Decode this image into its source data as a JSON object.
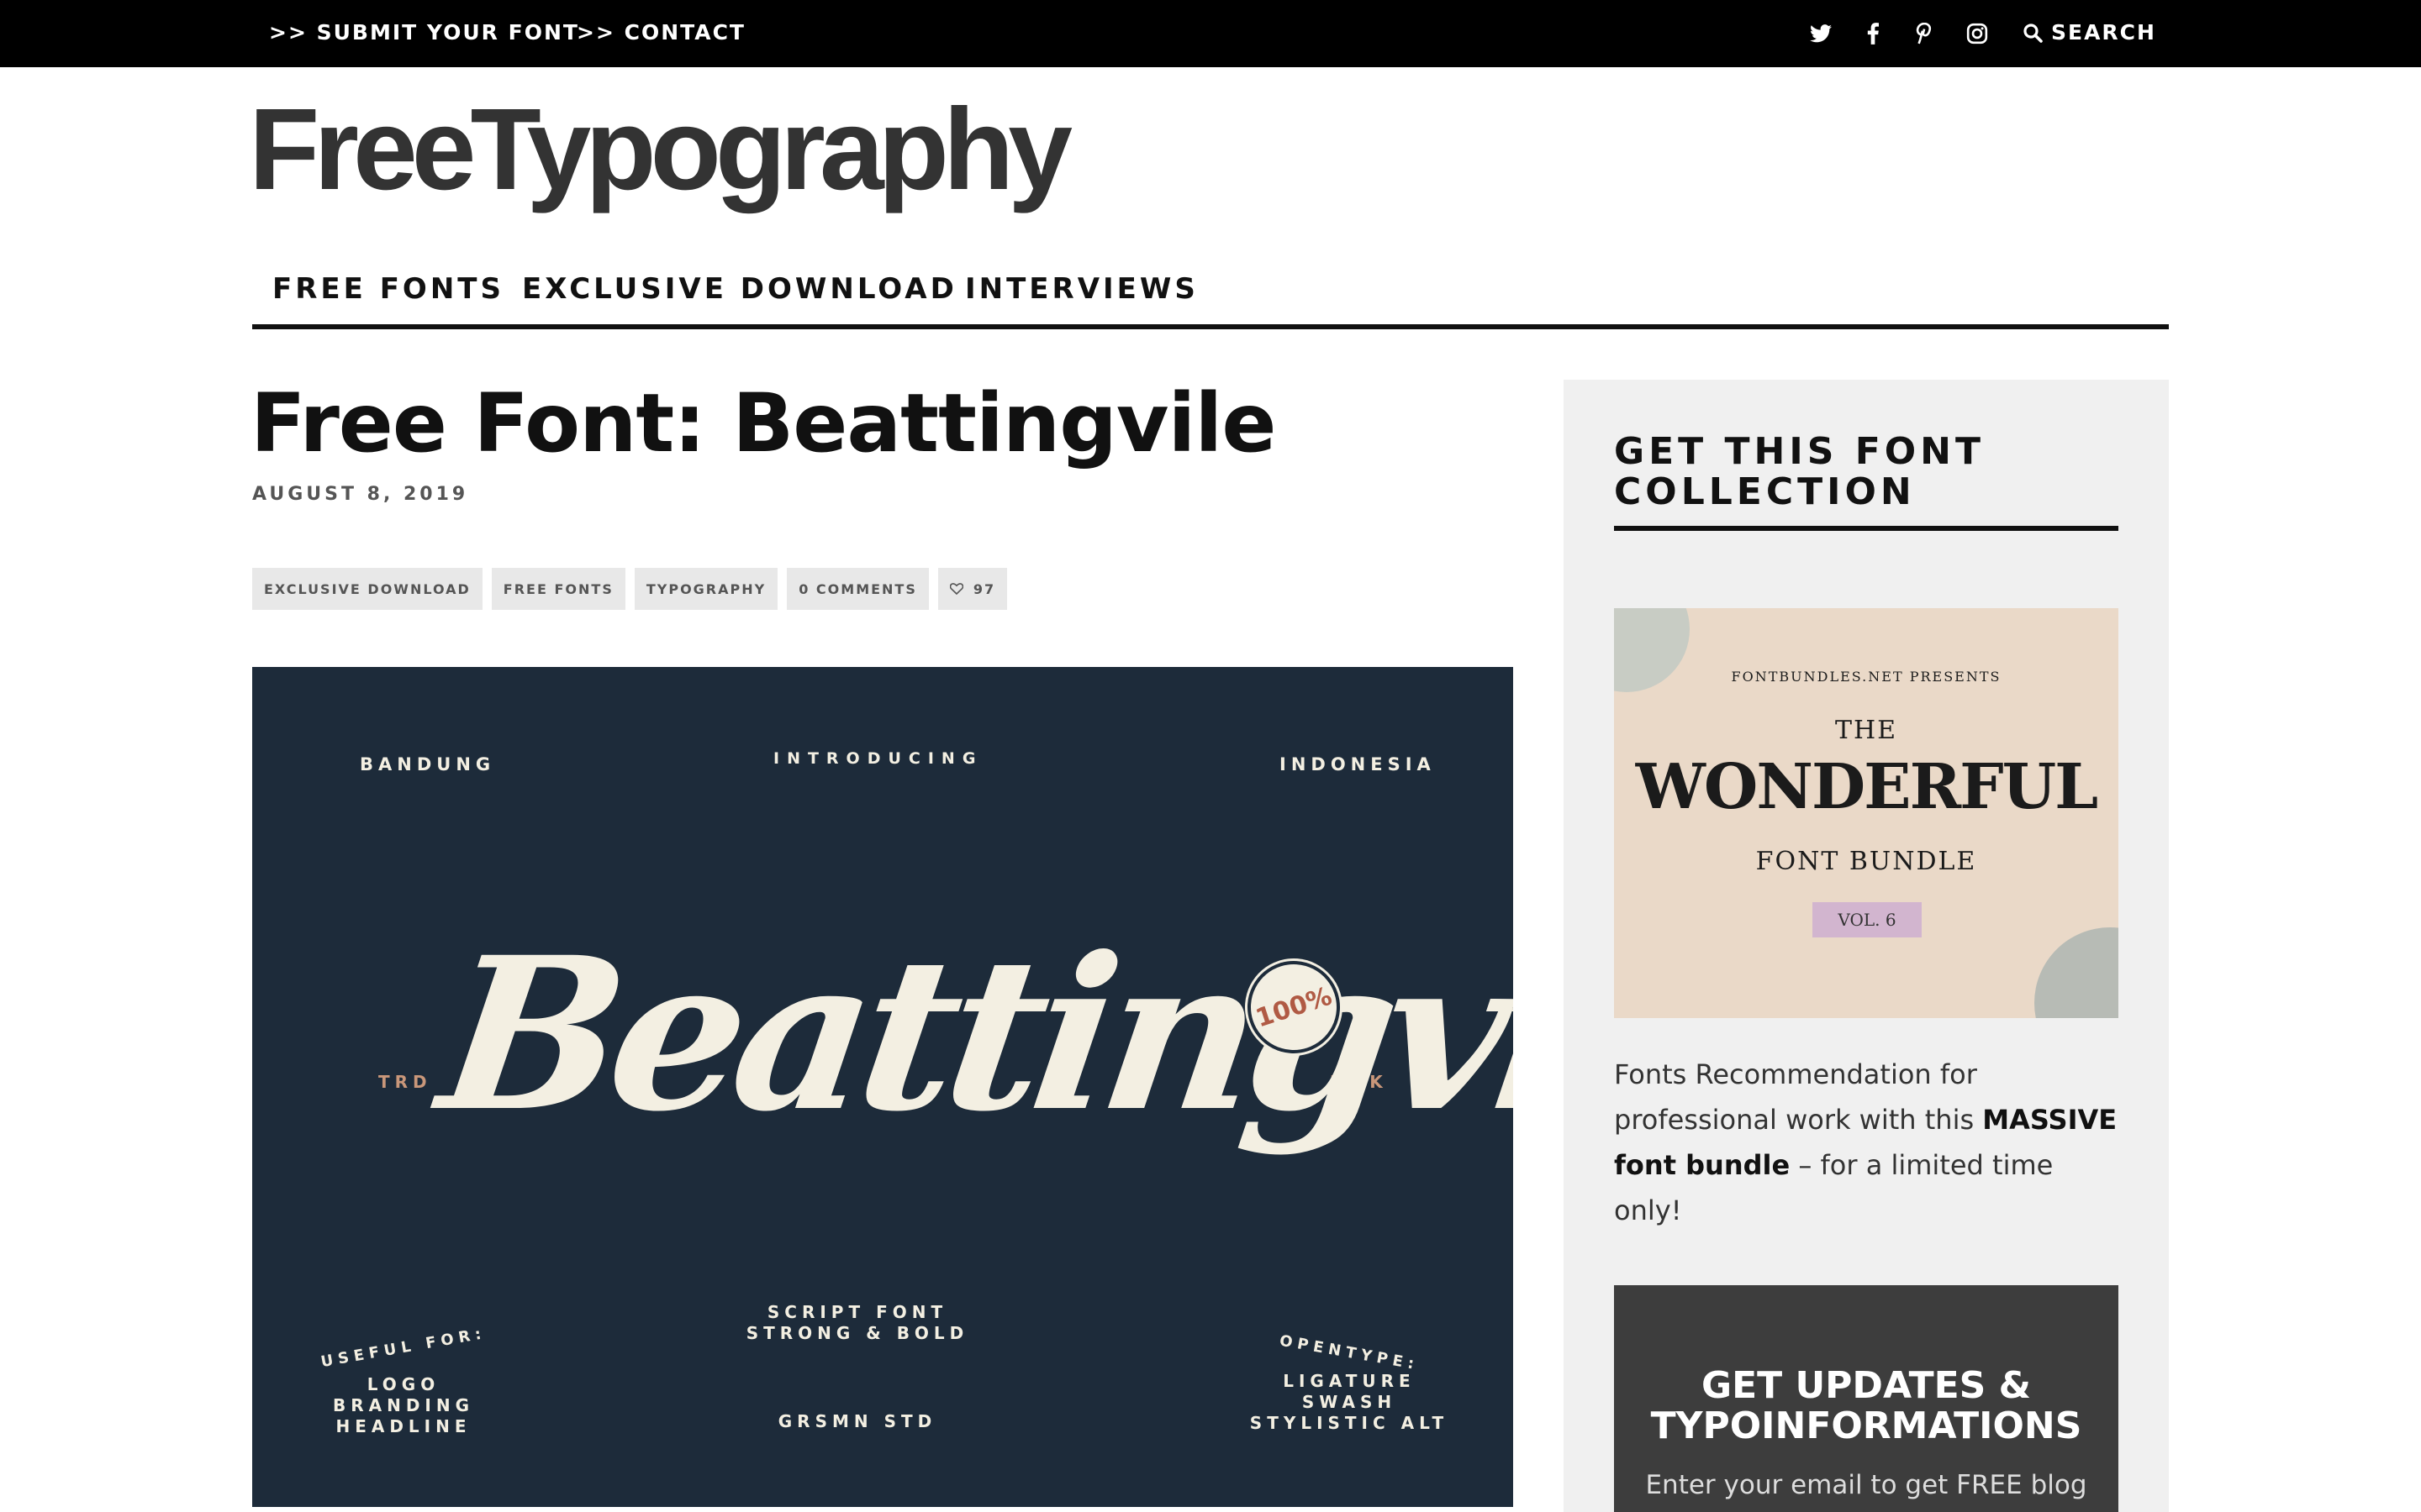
{
  "topbar": {
    "submit_label": ">> SUBMIT YOUR FONT",
    "contact_label": ">> CONTACT",
    "social_icons": [
      "twitter-icon",
      "facebook-icon",
      "pinterest-icon",
      "instagram-icon"
    ],
    "search_label": "SEARCH"
  },
  "header": {
    "logo_text": "FreeTypography"
  },
  "nav": {
    "items": [
      {
        "label": "FREE FONTS"
      },
      {
        "label": "EXCLUSIVE DOWNLOAD"
      },
      {
        "label": "INTERVIEWS"
      }
    ]
  },
  "article": {
    "title": "Free Font: Beattingvile",
    "date": "AUGUST 8, 2019",
    "tags": [
      "EXCLUSIVE DOWNLOAD",
      "FREE FONTS",
      "TYPOGRAPHY",
      "0 COMMENTS"
    ],
    "likes": "97",
    "hero": {
      "top_left": "BANDUNG",
      "top_center": "INTRODUCING",
      "top_right": "INDONESIA",
      "script_name": "Beattingvile",
      "badge_text": "100%",
      "side_left": "TRD",
      "side_right": "MRK",
      "bottom_left_title": "USEFUL FOR:",
      "bottom_left_lines": [
        "LOGO",
        "BRANDING",
        "HEADLINE"
      ],
      "bottom_center_lines": [
        "SCRIPT FONT",
        "STRONG & BOLD"
      ],
      "bottom_center_footer": "GRSMN STD",
      "bottom_right_title": "OPENTYPE:",
      "bottom_right_lines": [
        "LIGATURE",
        "SWASH",
        "STYLISTIC ALT"
      ]
    }
  },
  "sidebar": {
    "heading": "GET THIS FONT COLLECTION",
    "promo": {
      "presents": "FONTBUNDLES.NET PRESENTS",
      "the": "THE",
      "name": "WONDERFUL",
      "subtitle": "FONT BUNDLE",
      "volume": "VOL. 6"
    },
    "desc_before": "Fonts Recommendation for professional work with this ",
    "desc_bold": "MASSIVE font bundle",
    "desc_after": " – for a limited time only!",
    "newsletter_heading": "GET UPDATES & TYPOINFORMATIONS",
    "newsletter_text": "Enter your email to get FREE blog"
  },
  "colors": {
    "topbar_bg": "#000000",
    "hero_bg": "#1d2b3a",
    "sidebar_bg": "#f0f0f0",
    "newsletter_bg": "#3d3d3d",
    "accent": "#c9977a"
  }
}
